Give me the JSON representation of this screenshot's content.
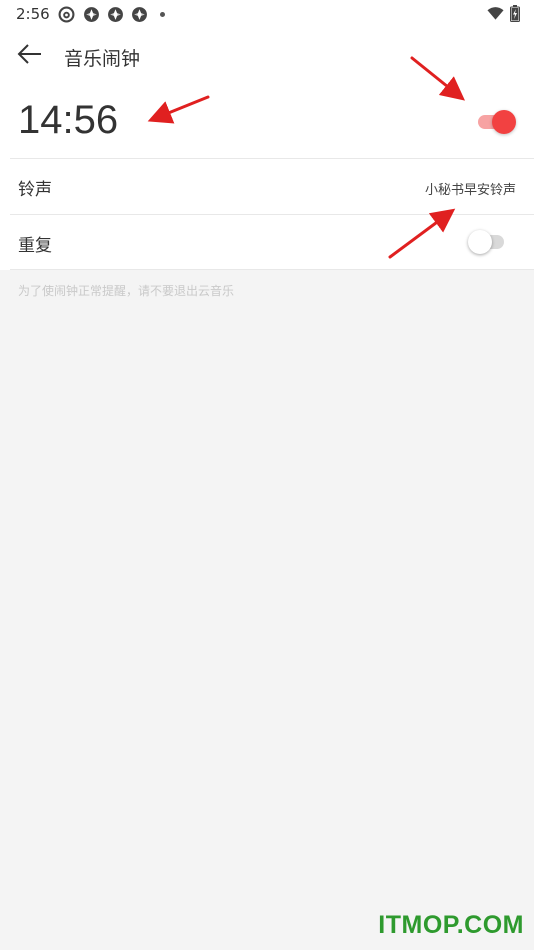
{
  "status_bar": {
    "time": "2:56",
    "icons": [
      "netease-music-icon",
      "aperture-icon",
      "aperture-icon",
      "aperture-icon"
    ],
    "right_icons": [
      "wifi-icon",
      "battery-charging-icon"
    ]
  },
  "header": {
    "back_icon": "arrow-left-icon",
    "title": "音乐闹钟"
  },
  "alarm": {
    "time": "14:56",
    "enabled": true
  },
  "settings": {
    "ringtone": {
      "label": "铃声",
      "value": "小秘书早安铃声"
    },
    "repeat": {
      "label": "重复",
      "enabled": false
    }
  },
  "hint": "为了使闹钟正常提醒，请不要退出云音乐",
  "watermark": "ITMOP.COM",
  "colors": {
    "accent": "#f24141",
    "accent_track": "#f7a3a3",
    "annotation": "#e02020",
    "watermark": "#2e9a2e"
  }
}
